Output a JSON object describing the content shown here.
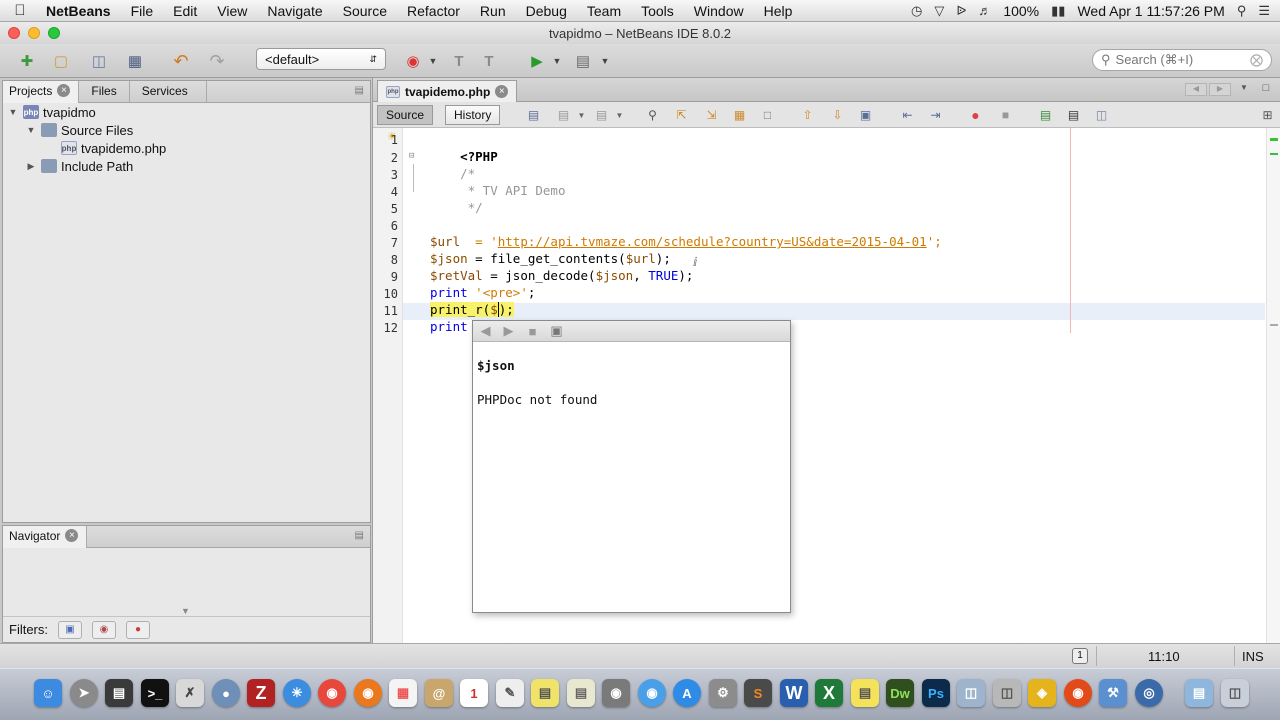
{
  "menubar": {
    "app_name": "NetBeans",
    "items": [
      "File",
      "Edit",
      "View",
      "Navigate",
      "Source",
      "Refactor",
      "Run",
      "Debug",
      "Team",
      "Tools",
      "Window",
      "Help"
    ],
    "battery": "100%",
    "clock": "Wed Apr 1  11:57:26 PM"
  },
  "window": {
    "title": "tvapidmo – NetBeans IDE 8.0.2"
  },
  "toolbar": {
    "config_value": "<default>",
    "search_placeholder": "Search (⌘+I)"
  },
  "projects_pane": {
    "tabs": [
      "Projects",
      "Files",
      "Services"
    ],
    "tree": {
      "project": "tvapidmo",
      "source_files": "Source Files",
      "file": "tvapidemo.php",
      "include_path": "Include Path"
    }
  },
  "navigator_pane": {
    "title": "Navigator",
    "filters_label": "Filters:"
  },
  "editor": {
    "tab_name": "tvapidemo.php",
    "source_label": "Source",
    "history_label": "History",
    "line_numbers": [
      "1",
      "2",
      "3",
      "4",
      "5",
      "6",
      "7",
      "8",
      "9",
      "10",
      "11",
      "12"
    ],
    "code": {
      "l1": "<?PHP",
      "l2": "/*",
      "l3": " * TV API Demo",
      "l4": " */",
      "l7_var": "$url",
      "l7_mid": "  = '",
      "l7_url": "http://api.tvmaze.com/schedule?country=US&date=2015-04-01",
      "l7_end": "';",
      "l8_var": "$json",
      "l8_mid": " = file_get_contents(",
      "l8_arg": "$url",
      "l8_end": ");",
      "l9_var": "$retVal",
      "l9_mid": " = json_decode(",
      "l9_arg": "$json",
      "l9_sep": ", ",
      "l9_true": "TRUE",
      "l9_end": ");",
      "l10_kw": "print",
      "l10_str": " '<pre>'",
      "l10_end": ";",
      "l11_fn": "print_r(",
      "l11_var": "$",
      "l11_end": ");",
      "l12_kw": "print"
    },
    "popup": {
      "symbol": "$json",
      "message": "PHPDoc not found"
    }
  },
  "statusbar": {
    "position": "11:10",
    "mode": "INS",
    "notification_count": "1"
  },
  "dock": {
    "items": [
      "Finder",
      "Launchpad",
      "Activity Monitor",
      "Terminal",
      "Preview",
      "Messages",
      "FileZilla",
      "Safari",
      "Chrome",
      "Firefox",
      "Apps",
      "Contacts",
      "Calendar",
      "TextEdit",
      "Stickies",
      "Notes",
      "FaceTime",
      "Messages",
      "App Store",
      "System Preferences",
      "Sublime Text",
      "Word",
      "Excel",
      "Stickies",
      "Dreamweaver",
      "Photoshop",
      "VirtualBox",
      "MySQL Workbench",
      "NetBeans",
      "Firefox",
      "Xcode",
      "Network",
      "Folder",
      "Trash"
    ]
  }
}
